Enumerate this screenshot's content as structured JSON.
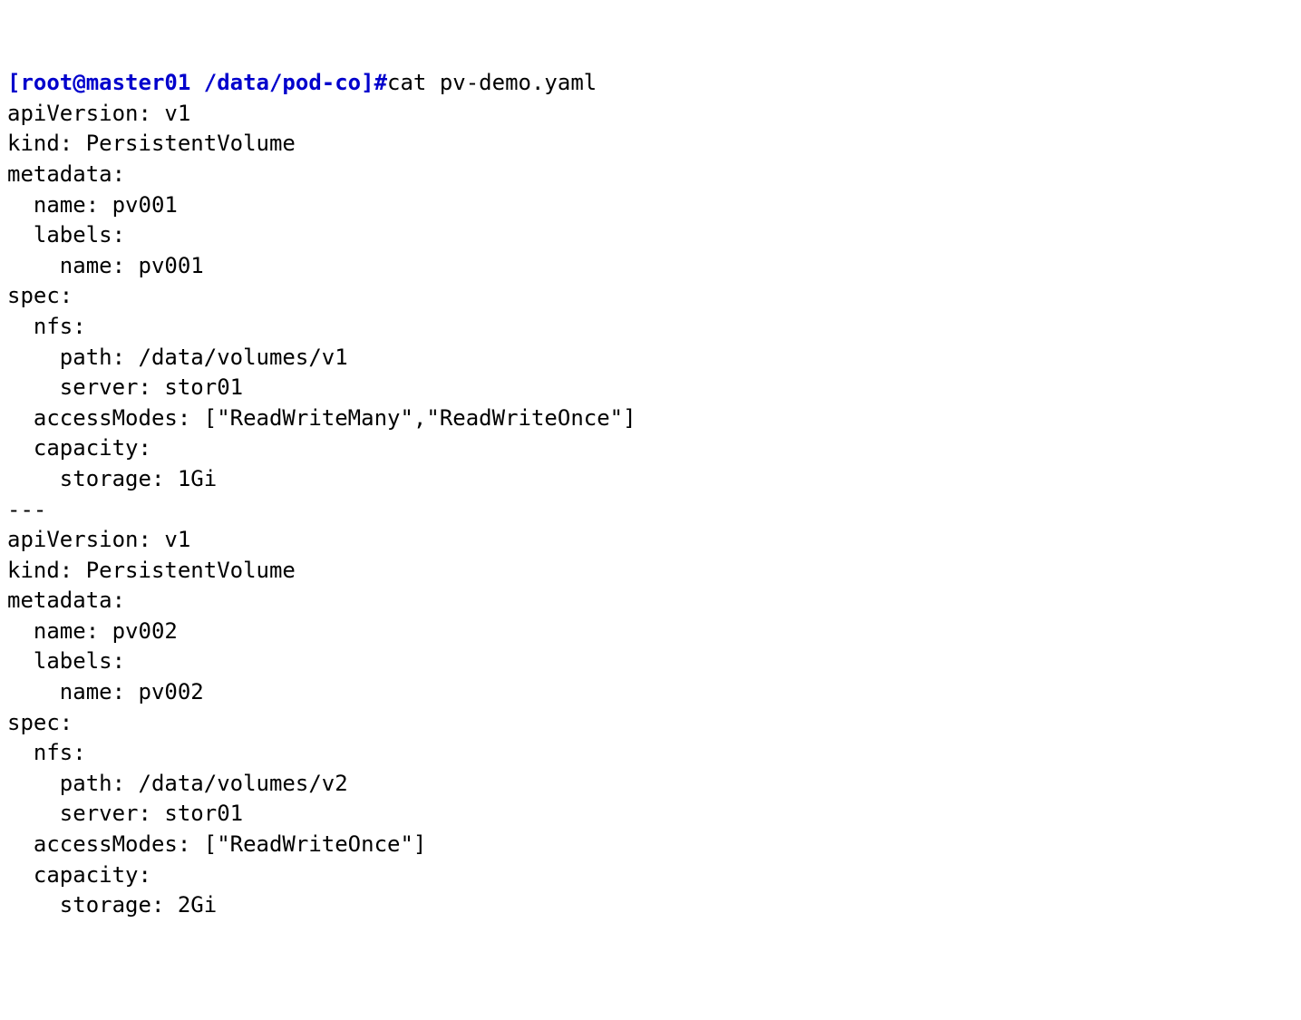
{
  "terminal": {
    "prompt": "[root@master01 /data/pod-co]#",
    "command": "cat pv-demo.yaml",
    "output_lines": [
      "apiVersion: v1",
      "kind: PersistentVolume",
      "metadata:",
      "  name: pv001",
      "  labels:",
      "    name: pv001",
      "spec:",
      "  nfs:",
      "    path: /data/volumes/v1",
      "    server: stor01",
      "  accessModes: [\"ReadWriteMany\",\"ReadWriteOnce\"]",
      "  capacity:",
      "    storage: 1Gi",
      "---",
      "apiVersion: v1",
      "kind: PersistentVolume",
      "metadata:",
      "  name: pv002",
      "  labels:",
      "    name: pv002",
      "spec:",
      "  nfs:",
      "    path: /data/volumes/v2",
      "    server: stor01",
      "  accessModes: [\"ReadWriteOnce\"]",
      "  capacity:",
      "    storage: 2Gi"
    ]
  }
}
